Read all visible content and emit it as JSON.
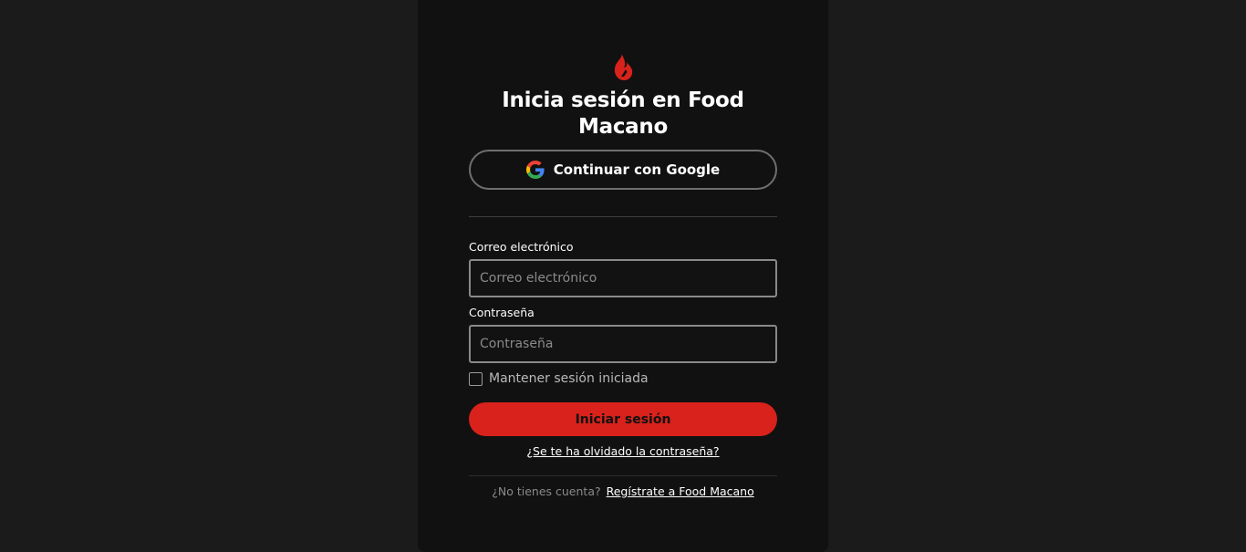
{
  "brand": {
    "logo_icon": "flame-icon",
    "accent_color": "#d9221b"
  },
  "login": {
    "title_line1": "Inicia sesión en Food",
    "title_line2": "Macano",
    "google_button_label": "Continuar con Google",
    "google_icon": "google-icon",
    "email_label": "Correo electrónico",
    "email_placeholder": "Correo electrónico",
    "email_value": "",
    "password_label": "Contraseña",
    "password_placeholder": "Contraseña",
    "password_value": "",
    "remember_label": "Mantener sesión iniciada",
    "remember_checked": false,
    "submit_label": "Iniciar sesión",
    "forgot_link": "¿Se te ha olvidado la contraseña?",
    "no_account_text": "¿No tienes cuenta?",
    "signup_link": "Regístrate a Food Macano"
  }
}
